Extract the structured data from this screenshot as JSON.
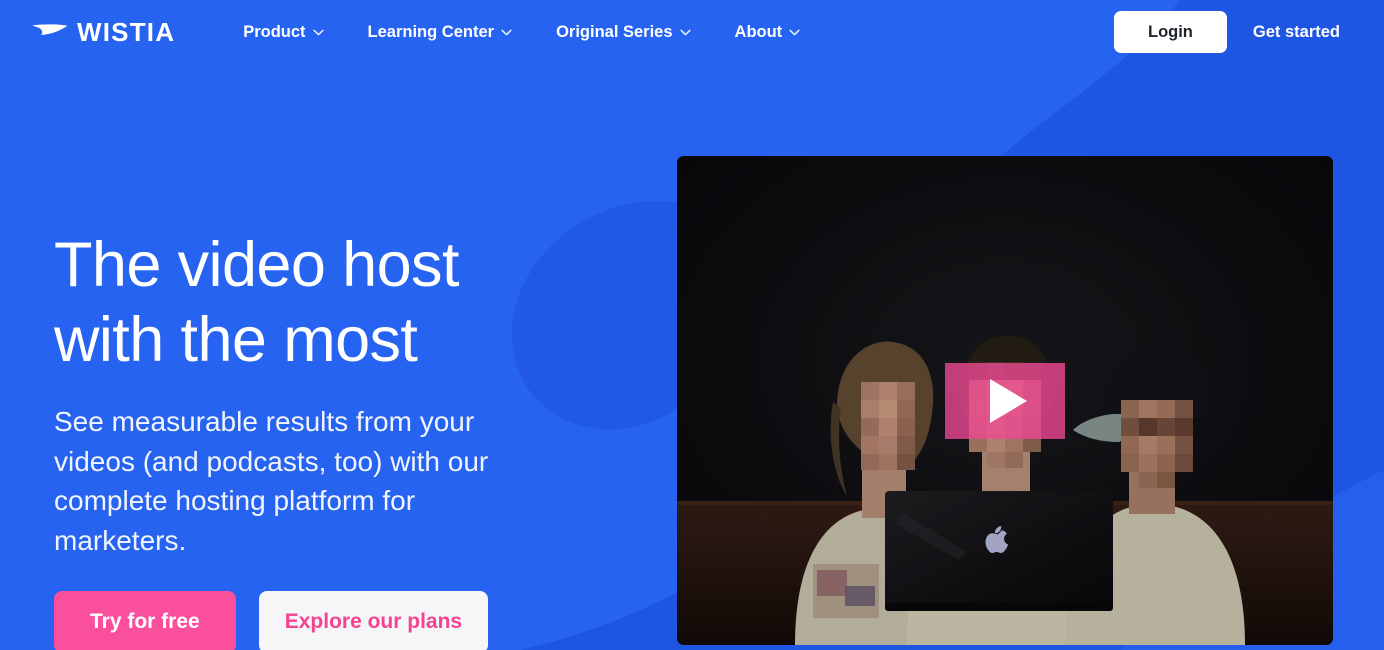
{
  "brand": {
    "name": "WISTIA",
    "logo_icon": "wistia-swoosh-icon",
    "blue": "#2563f0",
    "blue_dark": "#1b4fd8",
    "pink": "#fa4f9d",
    "pink_text": "#f5438f",
    "offwhite": "#f6f6f9"
  },
  "header": {
    "nav": [
      {
        "label": "Product",
        "icon": "chevron-down-icon"
      },
      {
        "label": "Learning Center",
        "icon": "chevron-down-icon"
      },
      {
        "label": "Original Series",
        "icon": "chevron-down-icon"
      },
      {
        "label": "About",
        "icon": "chevron-down-icon"
      }
    ],
    "login_label": "Login",
    "get_started_label": "Get started"
  },
  "hero": {
    "headline": "The video host with the most",
    "subhead": "See measurable results from your videos (and podcasts, too) with our complete hosting platform for marketers.",
    "cta_primary": "Try for free",
    "cta_secondary": "Explore our plans"
  },
  "video": {
    "play_icon": "play-triangle-icon",
    "thumbnail_description": "Three people seated at a table in a dark room behind an open laptop, faces pixelated"
  }
}
